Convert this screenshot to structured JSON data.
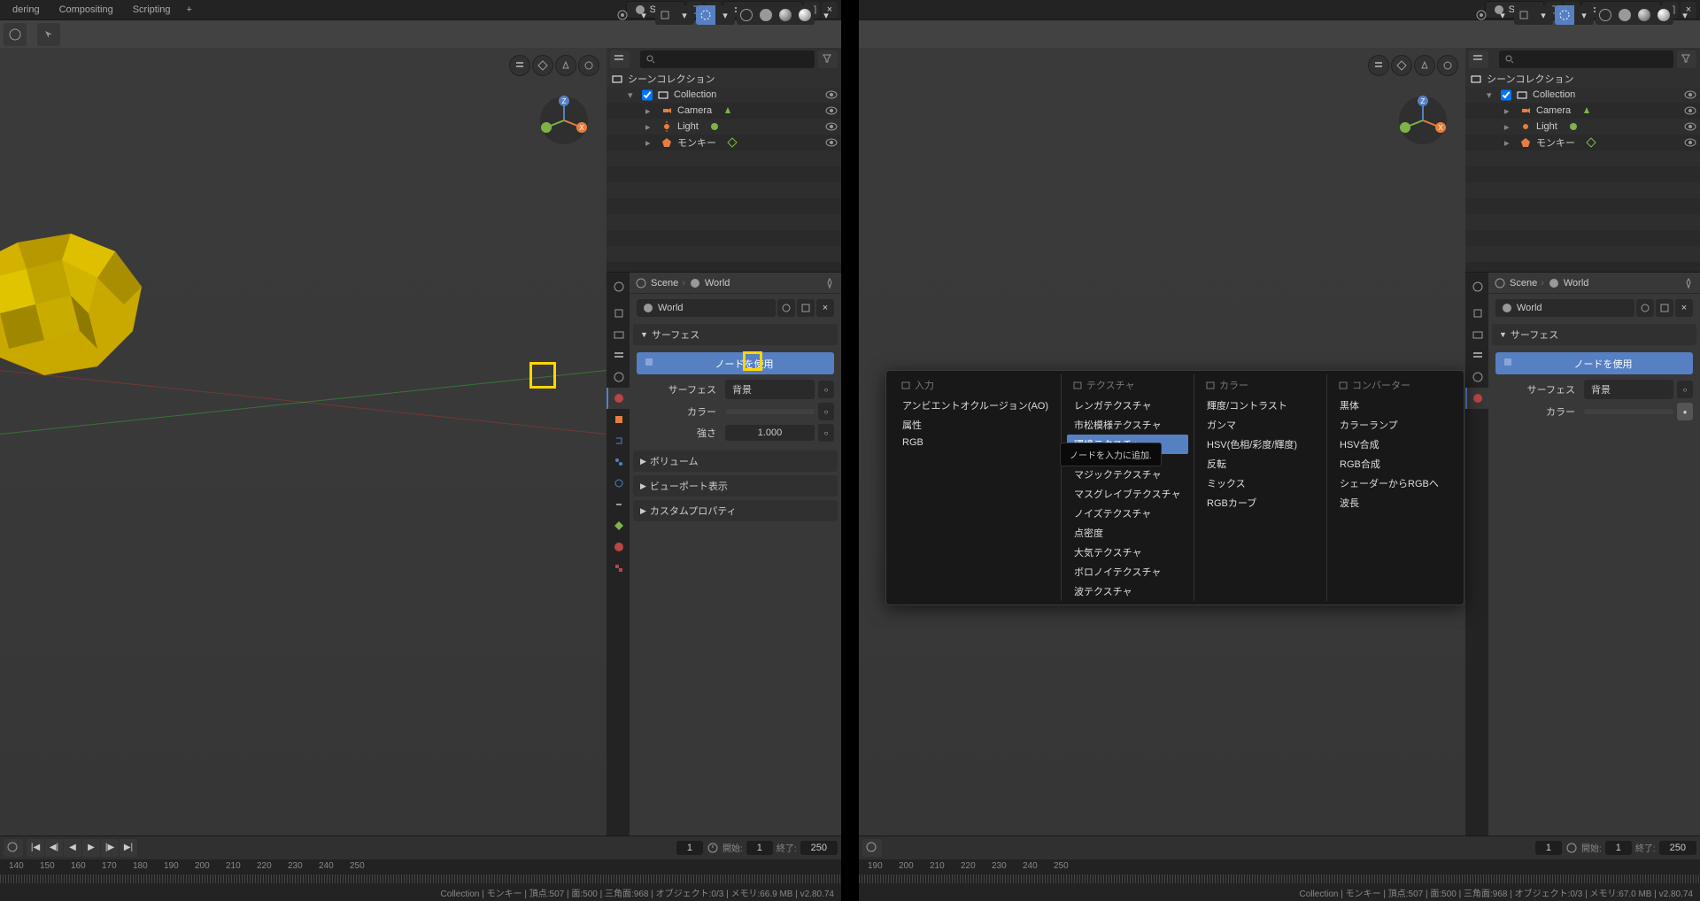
{
  "tabs": {
    "t1": "dering",
    "t2": "Compositing",
    "t3": "Scripting",
    "plus": "+"
  },
  "header": {
    "scene": "Scene",
    "view_layer": "View Layer"
  },
  "outliner": {
    "title": "シーンコレクション",
    "collection": "Collection",
    "camera": "Camera",
    "light": "Light",
    "monkey": "モンキー"
  },
  "properties": {
    "scene_crumb": "Scene",
    "world_crumb": "World",
    "world_name": "World",
    "surface_header": "サーフェス",
    "use_nodes": "ノードを使用",
    "surface_label": "サーフェス",
    "surface_value": "背景",
    "color_label": "カラー",
    "strength_label": "強さ",
    "strength_value": "1.000",
    "volume_header": "ボリューム",
    "viewport_header": "ビューポート表示",
    "custom_header": "カスタムプロパティ"
  },
  "timeline": {
    "current": "1",
    "start_label": "開始:",
    "start": "1",
    "end_label": "終了:",
    "end": "250",
    "ticks_left": [
      "140",
      "150",
      "160",
      "170",
      "180",
      "190",
      "200",
      "210",
      "220",
      "230",
      "240",
      "250"
    ],
    "ticks_right": [
      "190",
      "200",
      "210",
      "220",
      "230",
      "240",
      "250"
    ]
  },
  "status": {
    "left": "Collection | モンキー | 頂点:507 | 面:500 | 三角面:968 | オブジェクト:0/3 | メモリ:66.9 MB | v2.80.74",
    "right": "Collection | モンキー | 頂点:507 | 面:500 | 三角面:968 | オブジェクト:0/3 | メモリ:67.0 MB | v2.80.74"
  },
  "menu": {
    "tooltip": "ノードを入力に追加.",
    "col_input": "入力",
    "col_texture": "テクスチャ",
    "col_color": "カラー",
    "col_converter": "コンバーター",
    "input_items": [
      "アンビエントオクルージョン(AO)",
      "属性",
      "RGB"
    ],
    "texture_items": [
      "レンガテクスチャ",
      "市松模様テクスチャ",
      "環境テクスチャ",
      "",
      "",
      "マジックテクスチャ",
      "マスグレイブテクスチャ",
      "ノイズテクスチャ",
      "点密度",
      "大気テクスチャ",
      "ボロノイテクスチャ",
      "波テクスチャ"
    ],
    "color_items": [
      "輝度/コントラスト",
      "ガンマ",
      "HSV(色相/彩度/輝度)",
      "反転",
      "ミックス",
      "RGBカーブ"
    ],
    "converter_items": [
      "黒体",
      "カラーランプ",
      "HSV合成",
      "RGB合成",
      "シェーダーからRGBへ",
      "波長"
    ]
  }
}
